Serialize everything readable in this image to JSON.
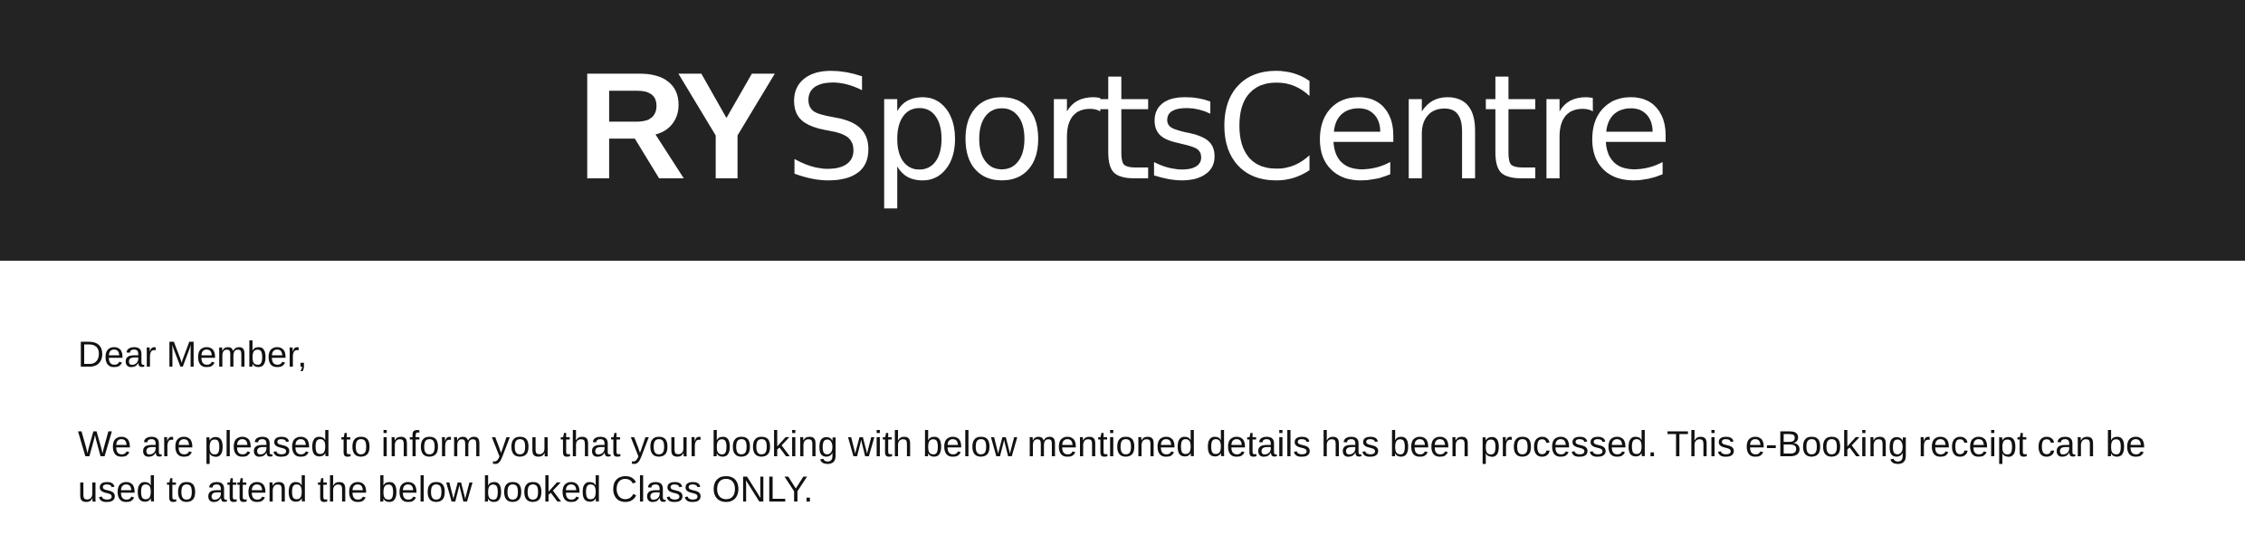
{
  "header": {
    "logo_bold": "RY",
    "logo_light": "SportsCentre",
    "background_color": "#232323",
    "text_color": "#ffffff"
  },
  "email": {
    "greeting": "Dear Member,",
    "message": "We are pleased to inform you that your booking with below mentioned details has been processed. This e-Booking receipt can be used to attend the below booked Class ONLY."
  }
}
